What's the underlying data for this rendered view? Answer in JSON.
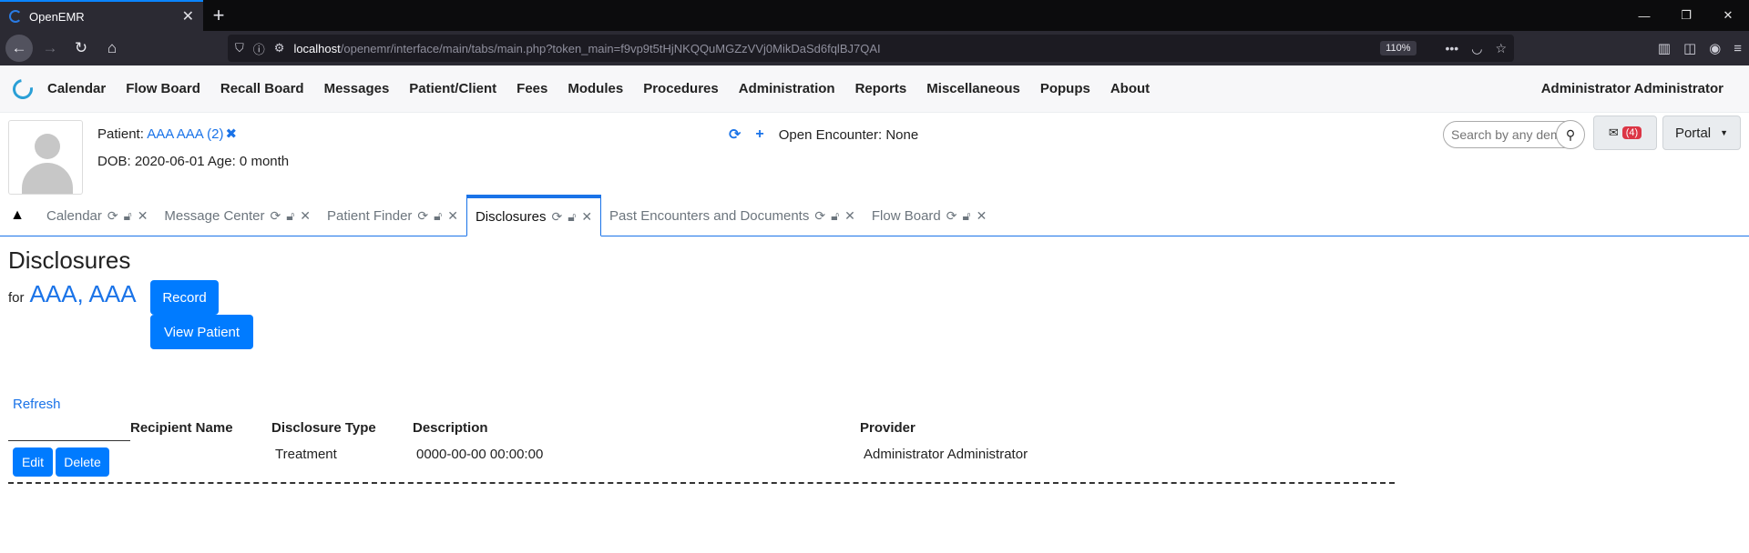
{
  "browser": {
    "tab_title": "OpenEMR",
    "url_host": "localhost",
    "url_path": "/openemr/interface/main/tabs/main.php?token_main=f9vp9t5tHjNKQQuMGZzVVj0MikDaSd6fqlBJ7QAI",
    "zoom": "110%"
  },
  "menu": {
    "items": [
      "Calendar",
      "Flow Board",
      "Recall Board",
      "Messages",
      "Patient/Client",
      "Fees",
      "Modules",
      "Procedures",
      "Administration",
      "Reports",
      "Miscellaneous",
      "Popups",
      "About"
    ],
    "user": "Administrator Administrator"
  },
  "patient": {
    "label": "Patient:",
    "name": "AAA AAA (2)",
    "dob_line": "DOB: 2020-06-01 Age: 0 month",
    "encounter": "Open Encounter: None",
    "search_placeholder": "Search by any demographics",
    "mail_count": "(4)",
    "portal": "Portal"
  },
  "tabs": [
    "Calendar",
    "Message Center",
    "Patient Finder",
    "Disclosures",
    "Past Encounters and Documents",
    "Flow Board"
  ],
  "page": {
    "title": "Disclosures",
    "for_label": "for",
    "patient_name": "AAA, AAA",
    "record_btn": "Record",
    "view_patient_btn": "View Patient",
    "refresh": "Refresh",
    "columns": {
      "recipient": "Recipient Name",
      "type": "Disclosure Type",
      "description": "Description",
      "provider": "Provider"
    },
    "rows": [
      {
        "edit": "Edit",
        "delete": "Delete",
        "recipient": "",
        "type": "Treatment",
        "description": "0000-00-00 00:00:00",
        "provider": "Administrator Administrator"
      }
    ]
  }
}
